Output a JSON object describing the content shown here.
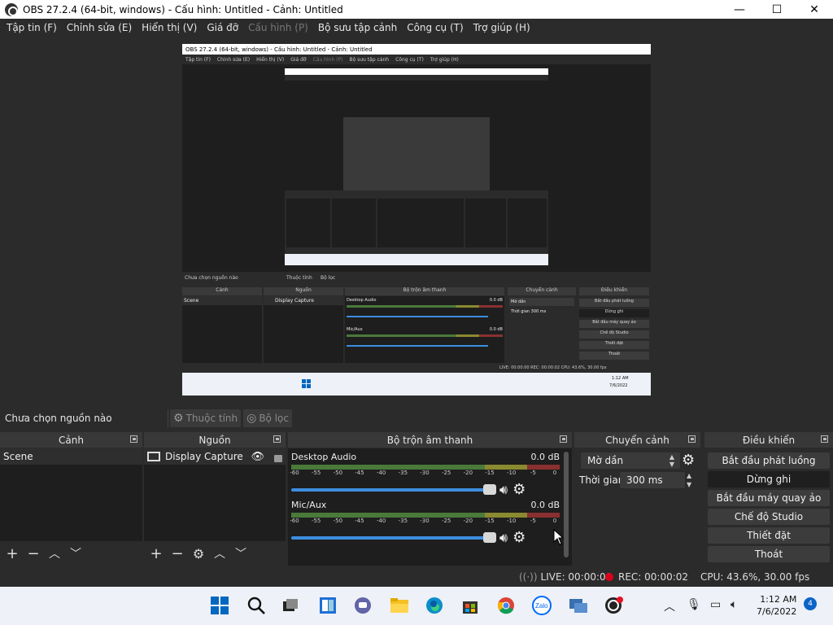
{
  "window": {
    "title": "OBS 27.2.4 (64-bit, windows) - Cấu hình: Untitled - Cảnh: Untitled",
    "min": "—",
    "max": "☐",
    "close": "✕"
  },
  "menu": {
    "items": [
      {
        "label": "Tập tin (F)"
      },
      {
        "label": "Chỉnh sửa (E)"
      },
      {
        "label": "Hiển thị (V)"
      },
      {
        "label": "Giá đỡ"
      },
      {
        "label": "Cấu hình (P)",
        "disabled": true
      },
      {
        "label": "Bộ sưu tập cảnh"
      },
      {
        "label": "Công cụ (T)"
      },
      {
        "label": "Trợ giúp (H)"
      }
    ]
  },
  "preview": {
    "nested_title": "OBS 27.2.4 (64-bit, windows) - Cấu hình: Untitled - Cảnh: Untitled",
    "nested_menu": [
      "Tập tin (F)",
      "Chỉnh sửa (E)",
      "Hiển thị (V)",
      "Giá đỡ",
      "Cấu hình (P)",
      "Bộ sưu tập cảnh",
      "Công cụ (T)",
      "Trợ giúp (H)"
    ],
    "nested_no_source": "Chưa chọn nguồn nào",
    "nested_props": "Thuộc tính",
    "nested_filters": "Bộ lọc",
    "nested_scenes": "Cảnh",
    "nested_sources": "Nguồn",
    "nested_mixer": "Bộ trộn âm thanh",
    "nested_transitions": "Chuyển cảnh",
    "nested_controls": "Điều khiển",
    "nested_scene": "Scene",
    "nested_source": "Display Capture",
    "nested_desktop_audio": "Desktop Audio",
    "nested_mic": "Mic/Aux",
    "nested_db": "0.0 dB",
    "nested_fade": "Mờ dần",
    "nested_duration_label": "Thời gian",
    "nested_duration": "300 ms",
    "nested_buttons": [
      "Bắt đầu phát luồng",
      "Dừng ghi",
      "Bắt đầu máy quay ảo",
      "Chế độ Studio",
      "Thiết đặt",
      "Thoát"
    ],
    "nested_status": "LIVE: 00:00:00   REC: 00:00:02   CPU: 43.6%, 30.00 fps",
    "nested_clock_time": "1:12 AM",
    "nested_clock_date": "7/6/2022"
  },
  "source_toolbar": {
    "no_source": "Chưa chọn nguồn nào",
    "properties": "Thuộc tính",
    "filters": "Bộ lọc"
  },
  "scenes": {
    "title": "Cảnh",
    "items": [
      "Scene"
    ]
  },
  "sources": {
    "title": "Nguồn",
    "items": [
      "Display Capture"
    ]
  },
  "mixer": {
    "title": "Bộ trộn âm thanh",
    "ticks": [
      "-60",
      "-55",
      "-50",
      "-45",
      "-40",
      "-35",
      "-30",
      "-25",
      "-20",
      "-15",
      "-10",
      "-5",
      "0"
    ],
    "channels": [
      {
        "name": "Desktop Audio",
        "db": "0.0 dB",
        "volume": 1.0
      },
      {
        "name": "Mic/Aux",
        "db": "0.0 dB",
        "volume": 1.0
      }
    ]
  },
  "transitions": {
    "title": "Chuyển cảnh",
    "selected": "Mờ dần",
    "duration_label": "Thời gian",
    "duration": "300 ms"
  },
  "controls": {
    "title": "Điều khiển",
    "buttons": [
      "Bắt đầu phát luồng",
      "Dừng ghi",
      "Bắt đầu máy quay ảo",
      "Chế độ Studio",
      "Thiết đặt",
      "Thoát"
    ]
  },
  "status": {
    "live": "LIVE: 00:00:00",
    "rec": "REC: 00:00:02",
    "cpu": "CPU: 43.6%, 30.00 fps"
  },
  "taskbar": {
    "time": "1:12 AM",
    "date": "7/6/2022",
    "notifications": "4"
  },
  "colors": {
    "accent": "#3c8ee0",
    "rec": "#d9001b"
  }
}
